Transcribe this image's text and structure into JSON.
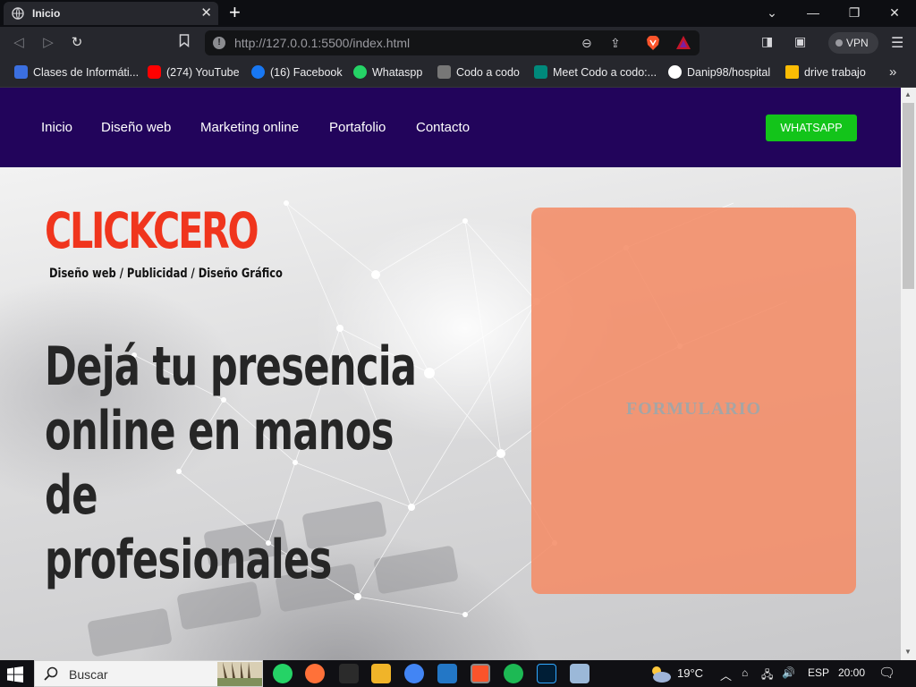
{
  "browser": {
    "tab_title": "Inicio",
    "url_host": "http://127.0.0.1",
    "url_rest": ":5500/index.html",
    "vpn_label": "VPN"
  },
  "bookmarks": [
    {
      "label": "Clases de Informáti...",
      "icon": "classroom-icon",
      "color": "#3b6fe0"
    },
    {
      "label": "(274) YouTube",
      "icon": "youtube-icon",
      "color": "#ff0000"
    },
    {
      "label": "(16) Facebook",
      "icon": "facebook-icon",
      "color": "#1877f2"
    },
    {
      "label": "Whataspp",
      "icon": "whatsapp-icon",
      "color": "#25d366"
    },
    {
      "label": "Codo a codo",
      "icon": "codoacodo-icon",
      "color": "#777777"
    },
    {
      "label": "Meet Codo a codo:...",
      "icon": "meet-icon",
      "color": "#00897b"
    },
    {
      "label": "Danip98/hospital",
      "icon": "github-icon",
      "color": "#ffffff"
    },
    {
      "label": "drive trabajo",
      "icon": "drive-icon",
      "color": "#fbbc04"
    }
  ],
  "site": {
    "nav": [
      "Inicio",
      "Diseño web",
      "Marketing online",
      "Portafolio",
      "Contacto"
    ],
    "whatsapp_button": "WHATSAPP",
    "logo": "CLICKCERO",
    "tagline": "Diseño web / Publicidad / Diseño Gráfico",
    "headline_lines": [
      "Dejá tu presencia",
      "online en manos de",
      "profesionales"
    ],
    "form_label": "FORMULARIO"
  },
  "taskbar": {
    "search_placeholder": "Buscar",
    "temperature": "19°C",
    "language": "ESP",
    "time": "20:00"
  },
  "colors": {
    "navbar": "#22045b",
    "logo": "#f0351d",
    "whatsapp": "#13c41a",
    "form": "#f48c66"
  }
}
